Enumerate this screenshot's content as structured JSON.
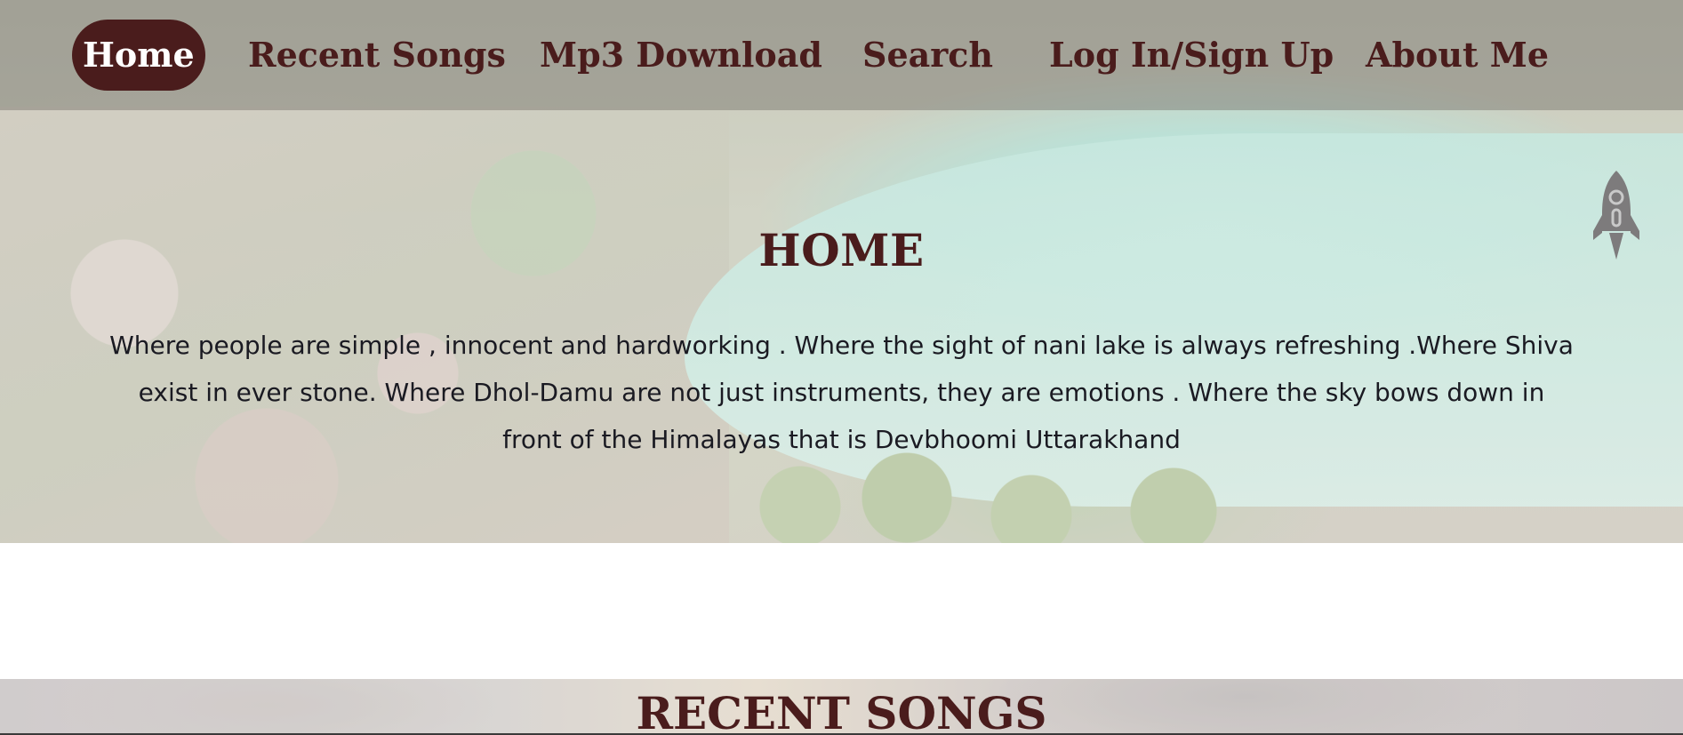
{
  "nav": {
    "items": [
      {
        "label": "Home",
        "active": true
      },
      {
        "label": "Recent Songs",
        "active": false
      },
      {
        "label": "Mp3 Download",
        "active": false
      },
      {
        "label": "Search",
        "active": false
      },
      {
        "label": "Log In/Sign Up",
        "active": false
      },
      {
        "label": "About Me",
        "active": false
      }
    ]
  },
  "home": {
    "heading": "HOME",
    "text": "Where people are simple , innocent and hardworking . Where the sight of nani lake is always refreshing .Where Shiva exist in ever stone. Where Dhol-Damu are not just instruments, they are emotions . Where the sky bows down in front of the Himalayas that is Devbhoomi Uttarakhand"
  },
  "scroll_button": {
    "icon": "rocket-icon"
  },
  "recent_songs": {
    "heading": "RECENT SONGS"
  },
  "colors": {
    "accent": "#4a1c1c",
    "nav_overlay": "#736e69",
    "body_text": "#1a1a22"
  }
}
